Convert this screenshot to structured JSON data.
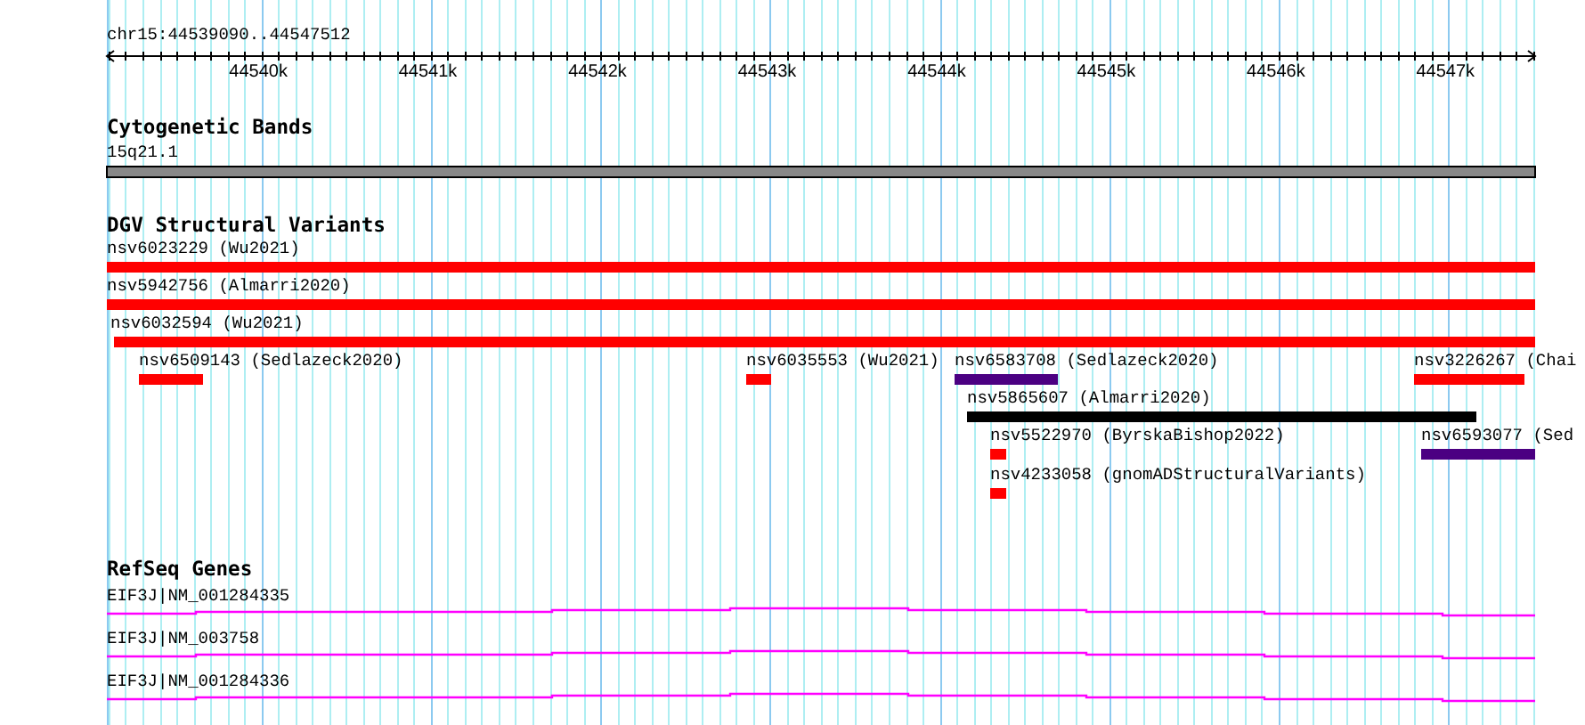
{
  "ruler": {
    "position": "chr15:44539090..44547512",
    "tick_labels": [
      "44540k",
      "44541k",
      "44542k",
      "44543k",
      "44544k",
      "44545k",
      "44546k",
      "44547k"
    ]
  },
  "tracks": [
    {
      "kind": "cytoband",
      "title": "Cytogenetic Bands",
      "bands": [
        {
          "label": "15q21.1"
        }
      ]
    },
    {
      "kind": "variants",
      "title": "DGV Structural Variants",
      "features": [
        {
          "label": "nsv6023229 (Wu2021)",
          "color": "#ff0000"
        },
        {
          "label": "nsv5942756 (Almarri2020)",
          "color": "#ff0000"
        },
        {
          "label": "nsv6032594 (Wu2021)",
          "color": "#ff0000"
        },
        {
          "label": "nsv6509143 (Sedlazeck2020)",
          "color": "#ff0000"
        },
        {
          "label": "nsv6035553 (Wu2021)",
          "color": "#ff0000"
        },
        {
          "label": "nsv6583708 (Sedlazeck2020)",
          "color": "#4b0082"
        },
        {
          "label": "nsv3226267 (Chai",
          "color": "#ff0000"
        },
        {
          "label": "nsv5865607 (Almarri2020)",
          "color": "#000000"
        },
        {
          "label": "nsv5522970 (ByrskaBishop2022)",
          "color": "#ff0000"
        },
        {
          "label": "nsv6593077 (Sed",
          "color": "#4b0082"
        },
        {
          "label": "nsv4233058 (gnomADStructuralVariants)",
          "color": "#ff0000"
        }
      ]
    },
    {
      "kind": "genes",
      "title": "RefSeq Genes",
      "genes": [
        {
          "label": "EIF3J|NM_001284335"
        },
        {
          "label": "EIF3J|NM_003758"
        },
        {
          "label": "EIF3J|NM_001284336"
        }
      ]
    }
  ]
}
